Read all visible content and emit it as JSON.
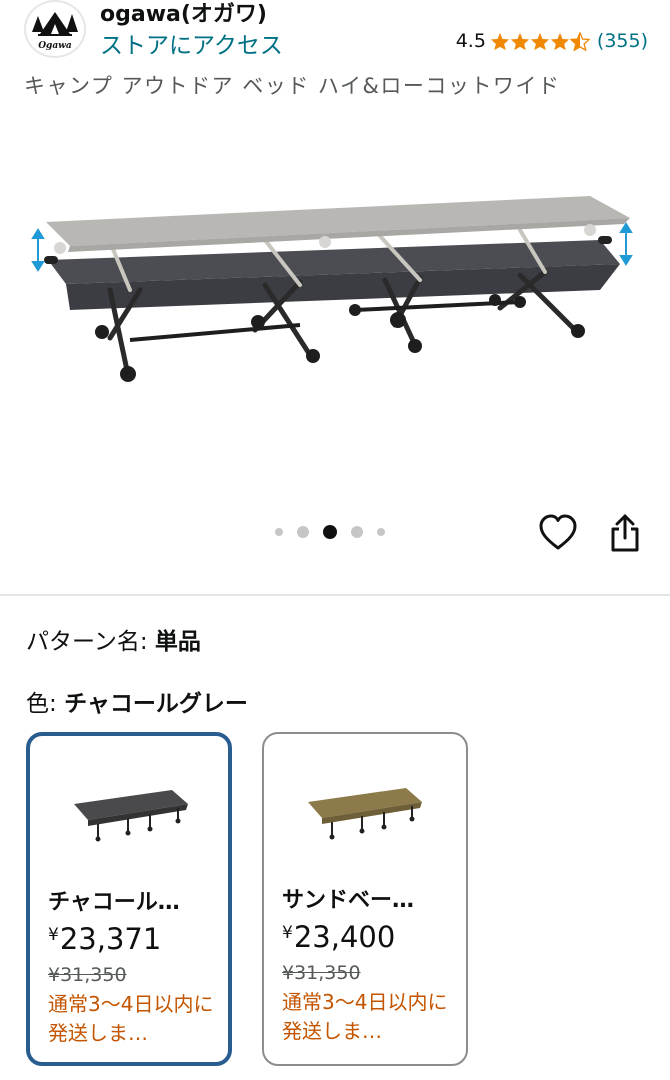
{
  "header": {
    "brand_name": "ogawa(オガワ)",
    "store_link": "ストアにアクセス",
    "rating_value": "4.5",
    "rating_count": "(355)",
    "stars": 4.5,
    "logo_text": "Ogawa"
  },
  "product": {
    "title": "キャンプ アウトドア ベッド ハイ&ローコットワイド"
  },
  "gallery": {
    "image_count": 5,
    "active_index": 2,
    "heart_icon": "heart-icon",
    "share_icon": "share-icon"
  },
  "variants": {
    "pattern_label": "パターン名:",
    "pattern_value": "単品",
    "color_label": "色:",
    "color_value": "チャコールグレー"
  },
  "options": [
    {
      "name": "チャコール…",
      "currency": "¥",
      "price": "23,371",
      "list_price": "¥31,350",
      "delivery": "通常3〜4日以内に発送しま…",
      "selected": true,
      "swatch_color": "#4a4a4d"
    },
    {
      "name": "サンドベー…",
      "currency": "¥",
      "price": "23,400",
      "list_price": "¥31,350",
      "delivery": "通常3〜4日以内に発送しま…",
      "selected": false,
      "swatch_color": "#8c7a4a"
    }
  ],
  "colors": {
    "link": "#007185",
    "star": "#f08804",
    "selected_border": "#2a5d8f",
    "delivery_text": "#c45500"
  }
}
